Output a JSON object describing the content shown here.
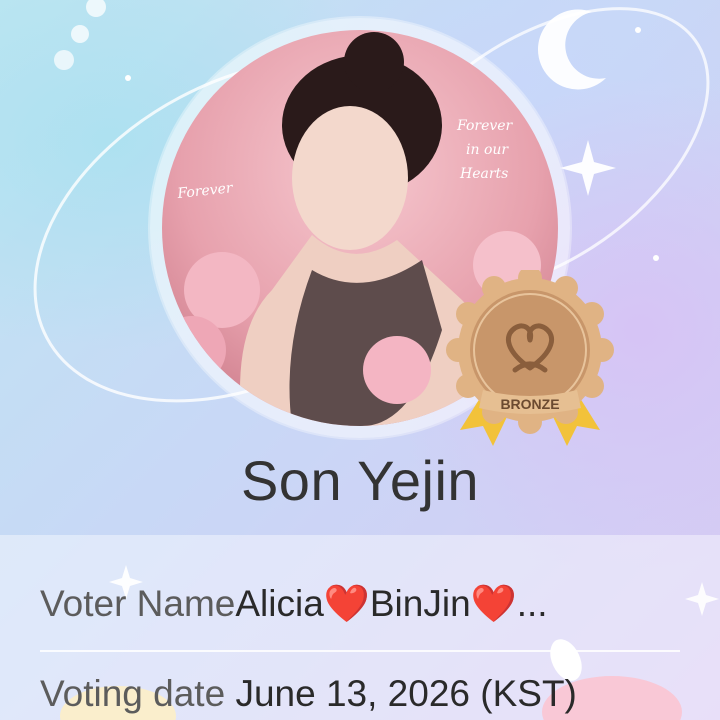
{
  "profile": {
    "name": "Son Yejin",
    "photo_description": "circular portrait photo with pink flowers",
    "photo_texts": {
      "left": "Forever",
      "right_line1": "Forever",
      "right_line2": "in our",
      "right_line3": "Hearts"
    }
  },
  "badge": {
    "label": "BRONZE",
    "icon": "heart-loop-icon"
  },
  "details": {
    "voter_label": "Voter Name",
    "voter_name_part1": "Alicia",
    "heart_glyph": "❤️",
    "voter_name_part2": "BinJin",
    "ellipsis": "...",
    "date_label": "Voting date",
    "date_value": "June 13, 2026 (KST)"
  },
  "colors": {
    "bronze": "#c8966a",
    "ribbon": "#f2c23a",
    "heart": "#e22a2a"
  }
}
